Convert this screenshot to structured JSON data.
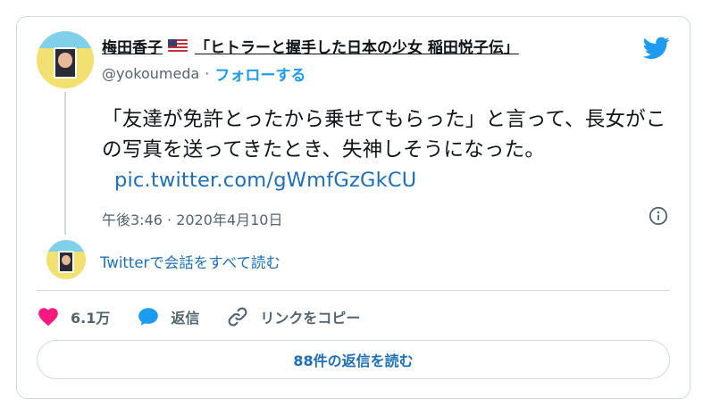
{
  "author": {
    "display_name": "梅田香子",
    "name_suffix": "「ヒトラーと握手した日本の少女 稲田悦子伝」",
    "handle": "@yokoumeda",
    "separator": "·",
    "follow_label": "フォローする"
  },
  "tweet": {
    "text": "「友達が免許とったから乗せてもらった」と言って、長女がこの写真を送ってきたとき、失神しそうになった。",
    "link": "pic.twitter.com/gWmfGzGkCU",
    "timestamp": "午後3:46 · 2020年4月10日"
  },
  "thread": {
    "read_label": "Twitterで会話をすべて読む"
  },
  "actions": {
    "like_count": "6.1万",
    "reply_label": "返信",
    "copy_link_label": "リンクをコピー"
  },
  "replies_button": {
    "label": "88件の返信を読む"
  },
  "colors": {
    "accent": "#1d9bf0",
    "link": "#1d6fb8",
    "like": "#f91880",
    "muted": "#536471",
    "border": "#cfd9de"
  },
  "icons": [
    "twitter-logo-icon",
    "us-flag-icon",
    "info-icon",
    "heart-icon",
    "reply-bubble-icon",
    "link-icon"
  ]
}
